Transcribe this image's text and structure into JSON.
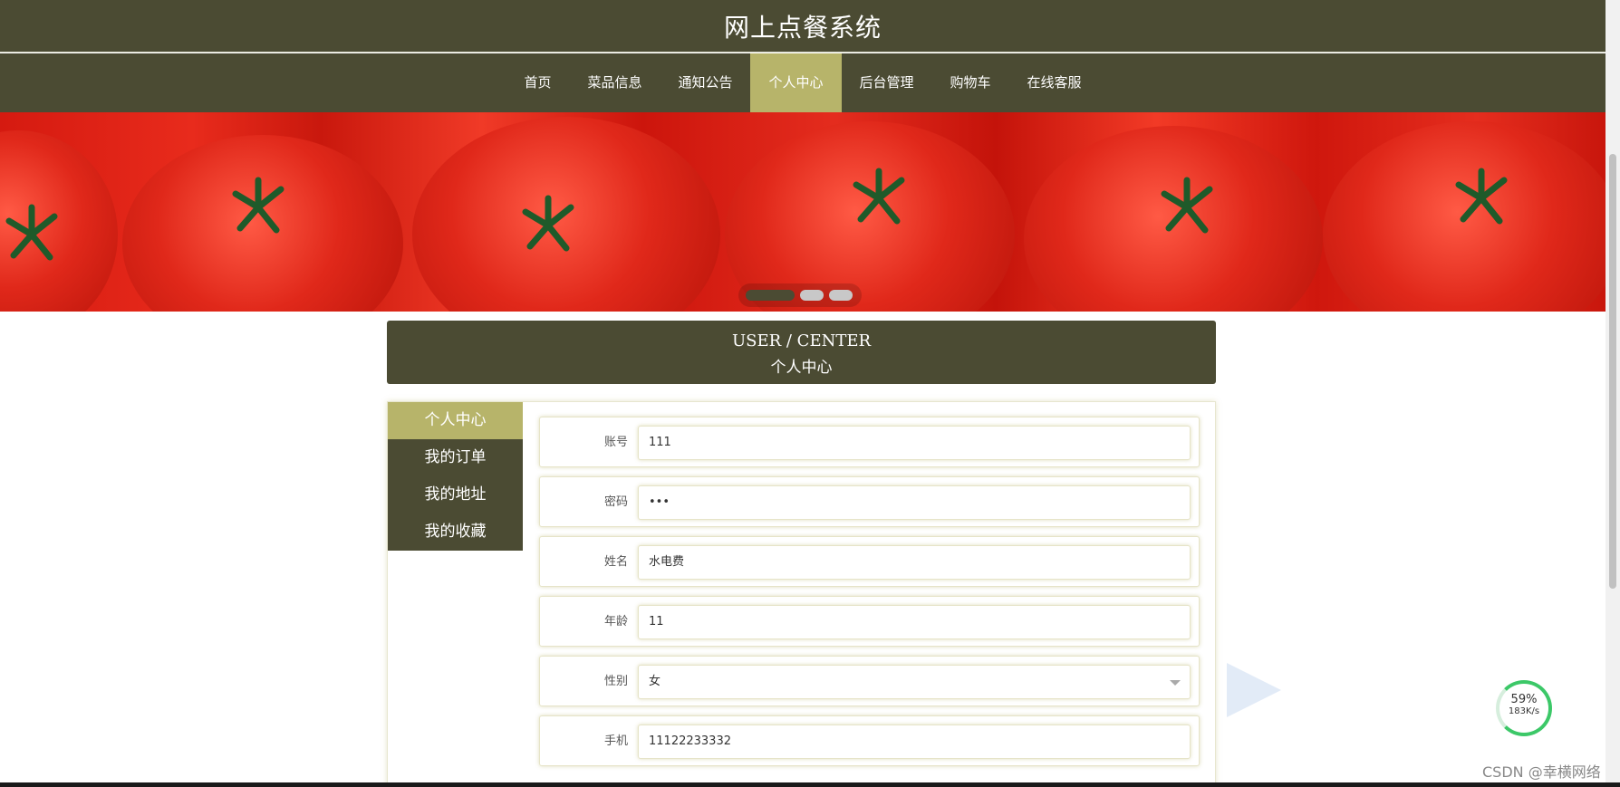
{
  "header": {
    "title": "网上点餐系统"
  },
  "nav": {
    "items": [
      {
        "label": "首页"
      },
      {
        "label": "菜品信息"
      },
      {
        "label": "通知公告"
      },
      {
        "label": "个人中心",
        "active": true
      },
      {
        "label": "后台管理"
      },
      {
        "label": "购物车"
      },
      {
        "label": "在线客服"
      }
    ]
  },
  "banner": {
    "slides": 3,
    "active_slide": 1
  },
  "section_title": {
    "en": "USER / CENTER",
    "cn": "个人中心"
  },
  "sidebar": {
    "items": [
      {
        "label": "个人中心",
        "active": true
      },
      {
        "label": "我的订单"
      },
      {
        "label": "我的地址"
      },
      {
        "label": "我的收藏"
      }
    ]
  },
  "form": {
    "fields": [
      {
        "label": "账号",
        "value": "111"
      },
      {
        "label": "密码",
        "value": "•••"
      },
      {
        "label": "姓名",
        "value": "水电费"
      },
      {
        "label": "年龄",
        "value": "11"
      },
      {
        "label": "性别",
        "value": "女"
      },
      {
        "label": "手机",
        "value": "11122233332"
      }
    ]
  },
  "widgets": {
    "speed": "183K/s",
    "percent": "59%",
    "watermark": "CSDN @幸横网络"
  },
  "colors": {
    "primary": "#4b4b33",
    "accent": "#b7b46a"
  }
}
